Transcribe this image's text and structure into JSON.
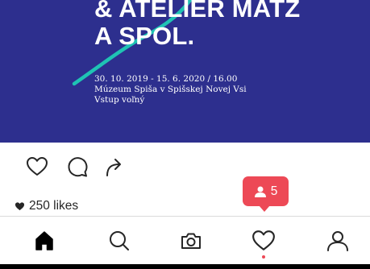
{
  "post": {
    "headline_lines": [
      "& ATELIÉR MATZ",
      "A SPOL."
    ],
    "detail_lines": [
      "30. 10. 2019 - 15. 6. 2020 / 16.00",
      "Múzeum Spiša v Spišskej Novej Vsi",
      "Vstup voľný"
    ],
    "colors": {
      "background": "#2d2f8e",
      "swoosh": "#1fc3b4"
    }
  },
  "actions": {
    "like_icon": "heart-outline-icon",
    "comment_icon": "comment-bubble-icon",
    "share_icon": "share-arrow-icon"
  },
  "likes": {
    "text": "250 likes"
  },
  "notification": {
    "count": "5",
    "icon": "person-icon",
    "color": "#ed4956"
  },
  "nav": {
    "items": [
      {
        "name": "home",
        "icon": "home-icon"
      },
      {
        "name": "search",
        "icon": "search-icon"
      },
      {
        "name": "camera",
        "icon": "camera-icon"
      },
      {
        "name": "activity",
        "icon": "heart-outline-icon"
      },
      {
        "name": "profile",
        "icon": "profile-icon"
      }
    ]
  }
}
